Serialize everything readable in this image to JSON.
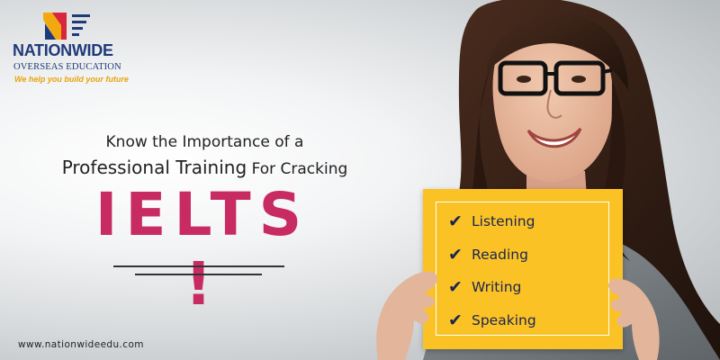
{
  "brand": {
    "name": "NATIONWIDE",
    "subtitle": "OVERSEAS EDUCATION",
    "tagline": "We help you build your future",
    "colors": {
      "navy": "#1f3a7a",
      "accent": "#e8a30c",
      "pink": "#c82a62"
    }
  },
  "headline": {
    "line1": "Know the Importance of a",
    "line2_part1": "Professional Training",
    "line2_part2": "For Cracking",
    "main": "IELTS !"
  },
  "card": {
    "color": "#fbc226",
    "items": [
      {
        "icon": "check-icon",
        "label": "Listening"
      },
      {
        "icon": "check-icon",
        "label": "Reading"
      },
      {
        "icon": "check-icon",
        "label": "Writing"
      },
      {
        "icon": "check-icon",
        "label": "Speaking"
      }
    ]
  },
  "footer": {
    "website": "www.nationwideedu.com"
  }
}
